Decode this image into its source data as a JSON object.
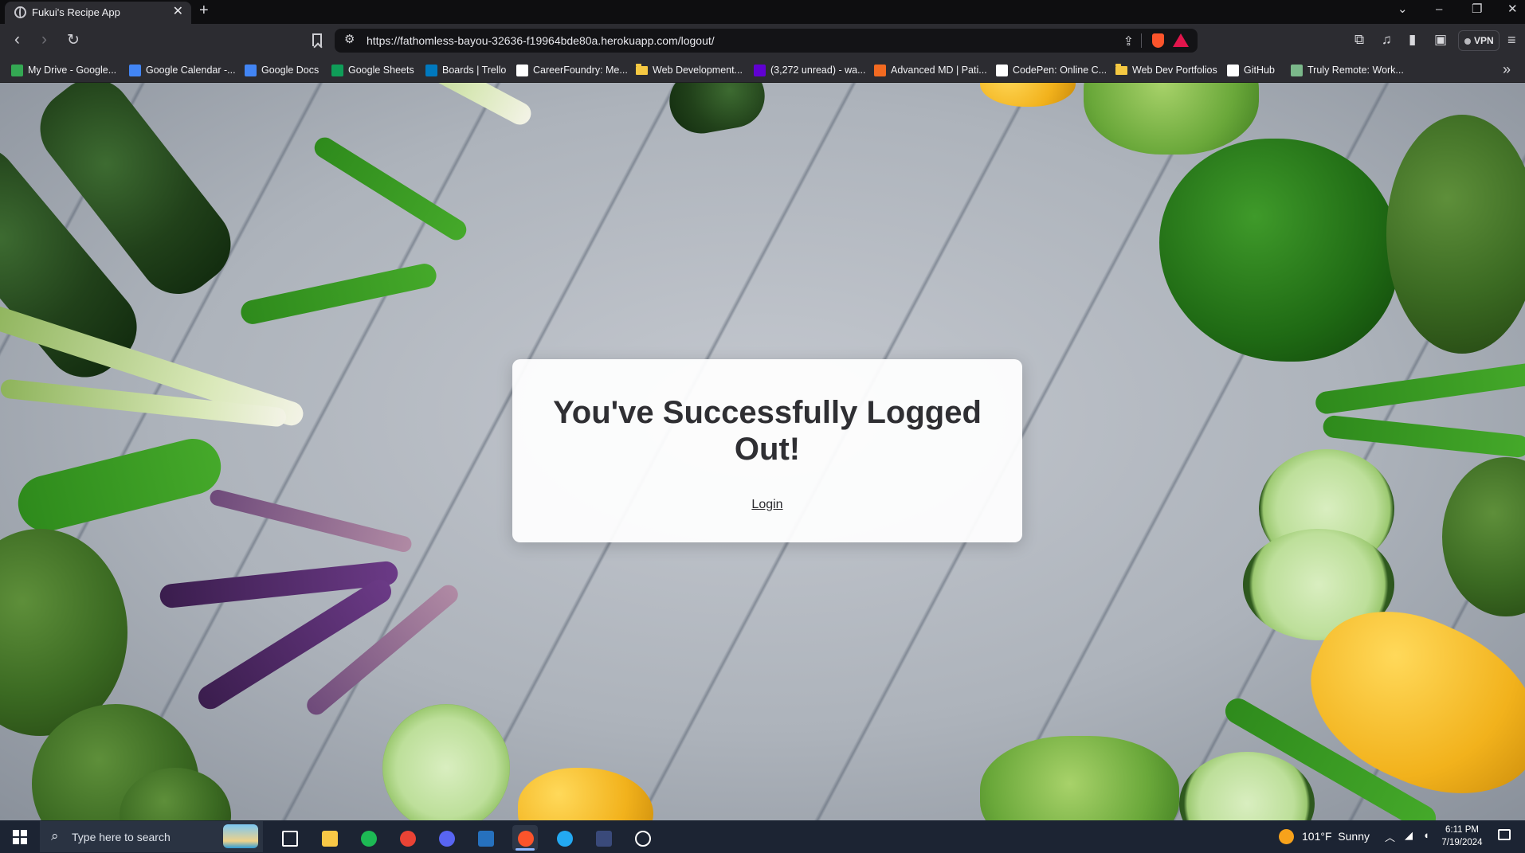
{
  "browser": {
    "tab": {
      "title": "Fukui's Recipe App",
      "close_glyph": "✕",
      "favicon": "globe-icon"
    },
    "new_tab_glyph": "+",
    "window_controls": {
      "dropdown": "⌄",
      "minimize": "–",
      "restore": "❐",
      "close": "✕"
    },
    "toolbar": {
      "back": "‹",
      "forward": "›",
      "reload": "↻",
      "url": "https://fathomless-bayou-32636-f19964bde80a.herokuapp.com/logout/",
      "vpn_label": "VPN"
    },
    "bookmarks": [
      {
        "label": "My Drive - Google...",
        "icon": "google-drive-icon",
        "color": "#34a853"
      },
      {
        "label": "Google Calendar -...",
        "icon": "google-calendar-icon",
        "color": "#4285f4"
      },
      {
        "label": "Google Docs",
        "icon": "google-docs-icon",
        "color": "#4285f4"
      },
      {
        "label": "Google Sheets",
        "icon": "google-sheets-icon",
        "color": "#0f9d58"
      },
      {
        "label": "Boards | Trello",
        "icon": "trello-icon",
        "color": "#0079bf"
      },
      {
        "label": "CareerFoundry: Me...",
        "icon": "careerfoundry-icon",
        "color": "#ffffff"
      },
      {
        "label": "Web Development...",
        "icon": "folder-icon",
        "color": "#f5c842"
      },
      {
        "label": "(3,272 unread) - wa...",
        "icon": "yahoo-mail-icon",
        "color": "#6001d2"
      },
      {
        "label": "Advanced MD | Pati...",
        "icon": "advancedmd-icon",
        "color": "#f26a21"
      },
      {
        "label": "CodePen: Online C...",
        "icon": "codepen-icon",
        "color": "#ffffff"
      },
      {
        "label": "Web Dev Portfolios",
        "icon": "folder-icon",
        "color": "#f5c842"
      },
      {
        "label": "GitHub",
        "icon": "github-icon",
        "color": "#ffffff"
      },
      {
        "label": "Truly Remote: Work...",
        "icon": "truly-remote-icon",
        "color": "#7bb88a"
      }
    ],
    "bookmarks_overflow": "»"
  },
  "page": {
    "heading": "You've Successfully Logged Out!",
    "login_link": "Login"
  },
  "taskbar": {
    "search_placeholder": "Type here to search",
    "apps": [
      {
        "name": "task-view-icon",
        "color": "#ffffff"
      },
      {
        "name": "file-explorer-icon",
        "color": "#f8c846"
      },
      {
        "name": "spotify-icon",
        "color": "#1db954"
      },
      {
        "name": "chrome-icon",
        "color": "#ea4335"
      },
      {
        "name": "discord-icon",
        "color": "#5865f2"
      },
      {
        "name": "powershell-icon",
        "color": "#2671be"
      },
      {
        "name": "brave-icon",
        "color": "#fb542b"
      },
      {
        "name": "vscode-icon",
        "color": "#23a9f2"
      },
      {
        "name": "app-window-icon",
        "color": "#3a4a7a"
      },
      {
        "name": "steam-icon",
        "color": "#ffffff"
      }
    ],
    "weather": {
      "temp": "101°F",
      "condition": "Sunny"
    },
    "clock": {
      "time": "6:11 PM",
      "date": "7/19/2024"
    }
  }
}
